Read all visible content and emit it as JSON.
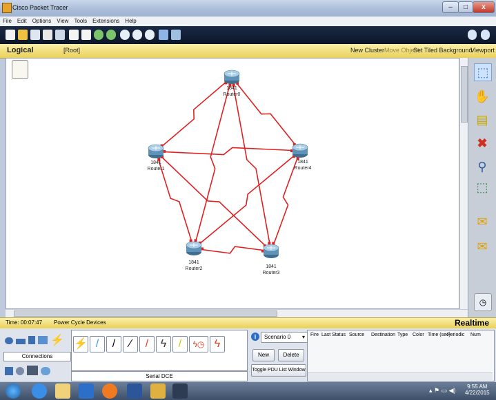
{
  "window": {
    "title": "Cisco Packet Tracer",
    "minimize": "–",
    "maximize": "□",
    "close": "x"
  },
  "menu": [
    "File",
    "Edit",
    "Options",
    "View",
    "Tools",
    "Extensions",
    "Help"
  ],
  "toolbar_icons": [
    "new-icon",
    "open-icon",
    "save-icon",
    "print-icon",
    "wizard-icon",
    "copy-icon",
    "paste-icon",
    "undo-icon",
    "redo-icon",
    "zoom-in-icon",
    "zoom-reset-icon",
    "zoom-out-icon",
    "palette-icon",
    "custom-device-icon"
  ],
  "help_icons": [
    "info-icon",
    "question-icon"
  ],
  "logical_bar": {
    "tab": "Logical",
    "root": "[Root]",
    "new_cluster": "New Cluster",
    "move_object": "Move Object",
    "set_tiled_background": "Set Tiled Background",
    "viewport": "Viewport"
  },
  "devices": [
    {
      "id": "r0",
      "model": "1841",
      "name": "Router0"
    },
    {
      "id": "r1",
      "model": "1841",
      "name": "Router1"
    },
    {
      "id": "r2",
      "model": "1841",
      "name": "Router2"
    },
    {
      "id": "r3",
      "model": "1841",
      "name": "Router3"
    },
    {
      "id": "r4",
      "model": "1841",
      "name": "Router4"
    }
  ],
  "links": [
    [
      "r0",
      "r1"
    ],
    [
      "r0",
      "r4"
    ],
    [
      "r0",
      "r2"
    ],
    [
      "r0",
      "r3"
    ],
    [
      "r1",
      "r4"
    ],
    [
      "r1",
      "r2"
    ],
    [
      "r1",
      "r3"
    ],
    [
      "r4",
      "r2"
    ],
    [
      "r4",
      "r3"
    ],
    [
      "r2",
      "r3"
    ]
  ],
  "right_tools": [
    "select-icon",
    "hand-icon",
    "note-icon",
    "delete-icon",
    "inspect-icon",
    "resize-icon",
    "add-simple-pdu-icon",
    "add-complex-pdu-icon"
  ],
  "status": {
    "time": "Time: 00:07:47",
    "power_cycle": "Power Cycle Devices",
    "mode": "Realtime"
  },
  "bottom": {
    "category_label": "Connections",
    "selected_connection": "Serial DCE",
    "scenario": "Scenario 0",
    "new_btn": "New",
    "delete_btn": "Delete",
    "toggle_btn": "Toggle PDU List Window",
    "pdu_columns": [
      "Fire",
      "Last Status",
      "Source",
      "Destination",
      "Type",
      "Color",
      "Time (sec)",
      "Periodic",
      "Num"
    ]
  },
  "taskbar": {
    "time": "9:55 AM",
    "date": "4/22/2015"
  },
  "colors": {
    "link": "#e02020",
    "logical_bar": "#e9d05a",
    "toolbar": "#0c1628"
  }
}
